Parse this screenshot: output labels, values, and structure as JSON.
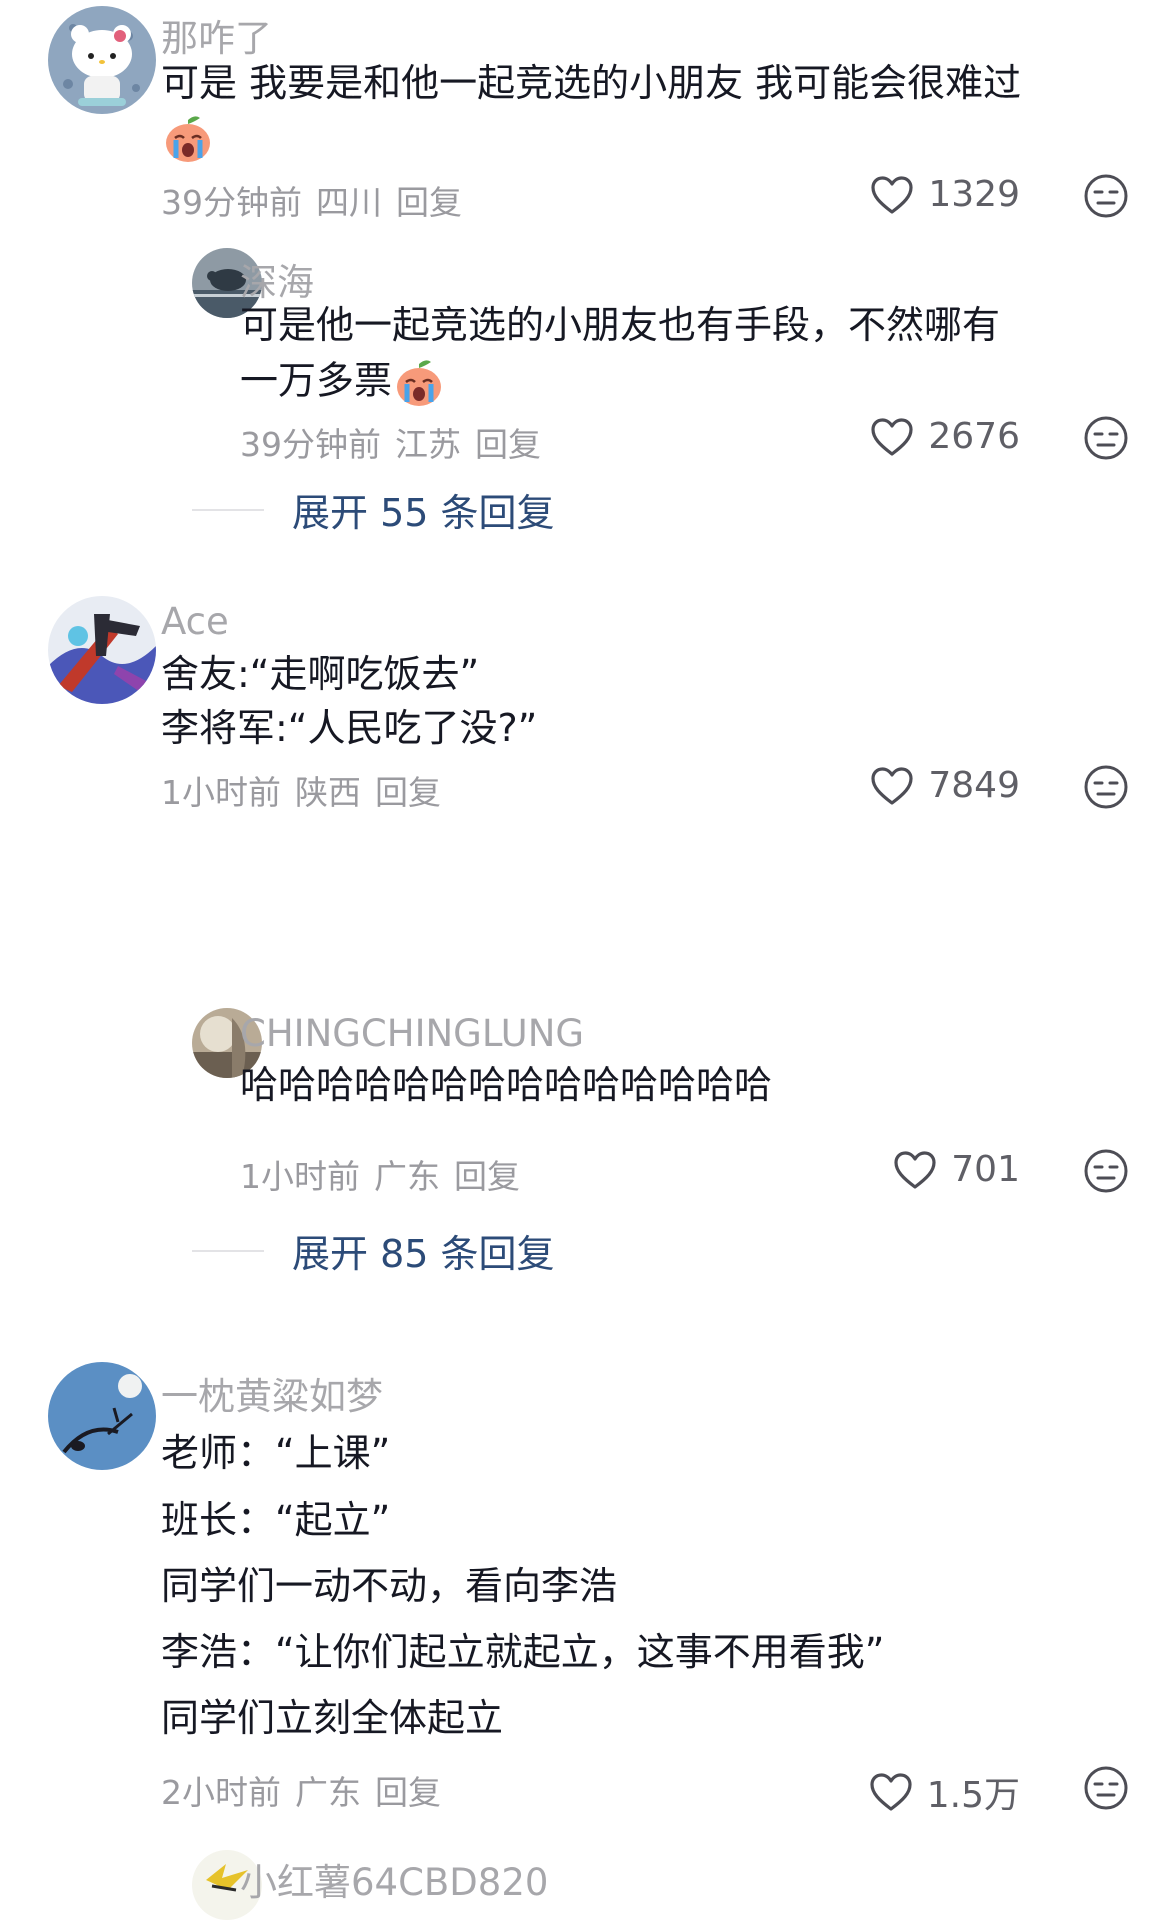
{
  "comments": [
    {
      "user": "那咋了",
      "lines": [
        "可是 我要是和他一起竞选的小朋友 我可能会很难过"
      ],
      "time": "39分钟前",
      "location": "四川",
      "reply_label": "回复",
      "likes": "1329",
      "has_emoji": true
    },
    {
      "user": "深海",
      "lines": [
        "可是他一起竞选的小朋友也有手段，不然哪有",
        "一万多票"
      ],
      "time": "39分钟前",
      "location": "江苏",
      "reply_label": "回复",
      "likes": "2676",
      "has_emoji": true,
      "expand": "展开 55 条回复"
    },
    {
      "user": "Ace",
      "lines": [
        "舍友:“走啊吃饭去”",
        "李将军:“人民吃了没?”"
      ],
      "time": "1小时前",
      "location": "陕西",
      "reply_label": "回复",
      "likes": "7849"
    },
    {
      "user": "CHINGCHINGLUNG",
      "lines": [
        "哈哈哈哈哈哈哈哈哈哈哈哈哈哈"
      ],
      "time": "1小时前",
      "location": "广东",
      "reply_label": "回复",
      "likes": "701",
      "expand": "展开 85 条回复"
    },
    {
      "user": "一枕黄粱如梦",
      "lines": [
        "老师：“上课”",
        "班长：“起立”",
        "同学们一动不动，看向李浩",
        "李浩：“让你们起立就起立，这事不用看我”",
        "同学们立刻全体起立"
      ],
      "time": "2小时前",
      "location": "广东",
      "reply_label": "回复",
      "likes": "1.5万"
    },
    {
      "user": "小红薯64CBD820"
    }
  ],
  "icons": {
    "like": "heart-outline-icon",
    "dislike": "neutral-face-icon",
    "emoji": "crying-peach-emoji"
  },
  "colors": {
    "username": "#a7a7ab",
    "text": "#161823",
    "meta": "#9a9a9f",
    "expand": "#2c4b78"
  }
}
